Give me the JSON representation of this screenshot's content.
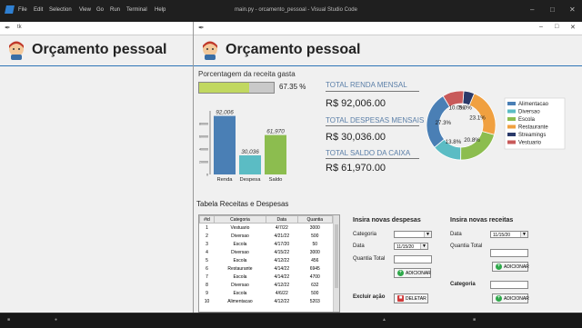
{
  "vscode": {
    "menu": [
      "File",
      "Edit",
      "Selection",
      "View",
      "Go",
      "Run",
      "Terminal",
      "Help"
    ],
    "title": "main.py - orcamento_pessoal - Visual Studio Code"
  },
  "window1": {
    "title": "tk",
    "app_title": "Orçamento pessoal"
  },
  "window2": {
    "app_title": "Orçamento pessoal"
  },
  "percent": {
    "title": "Porcentagem da receita gasta",
    "value_text": "67.35 %",
    "value": 0.6735
  },
  "stats": [
    {
      "label": "TOTAL RENDA MENSAL",
      "value": "R$ 92,006.00"
    },
    {
      "label": "TOTAL DESPESAS MENSAIS",
      "value": "R$ 30,036.00"
    },
    {
      "label": "TOTAL SALDO DA CAIXA",
      "value": "R$ 61,970.00"
    }
  ],
  "chart_data": [
    {
      "type": "bar",
      "categories": [
        "Renda",
        "Despesa",
        "Saldo"
      ],
      "values": [
        92006,
        30036,
        61970
      ],
      "value_labels": [
        "92,006",
        "30,036",
        "61,970"
      ],
      "colors": [
        "#4a7fb5",
        "#5bbcc4",
        "#8cbd4f"
      ],
      "yticks": [
        "80000",
        "60000",
        "40000",
        "20000",
        "0"
      ],
      "ylim": [
        0,
        100000
      ]
    },
    {
      "type": "pie",
      "donut": true,
      "labels": [
        "Alimentacao",
        "Diversao",
        "Escola",
        "Restaurante",
        "Streamings",
        "Vestuario"
      ],
      "values": [
        27.3,
        13.8,
        20.8,
        23.1,
        5.0,
        10.0
      ],
      "value_labels": [
        "27.3%",
        "13.8%",
        "20.8%",
        "23.1%",
        "5.0%",
        "10.0%"
      ],
      "colors": [
        "#4a7fb5",
        "#5bbcc4",
        "#8cbd4f",
        "#f0a040",
        "#2a3a6a",
        "#c85a5a"
      ],
      "legend": "right"
    }
  ],
  "table": {
    "title": "Tabela Receitas e Despesas",
    "headers": [
      "#id",
      "Categoria",
      "Data",
      "Quantia"
    ],
    "rows": [
      [
        "1",
        "Vestuario",
        "4/7/22",
        "3000"
      ],
      [
        "2",
        "Diversao",
        "4/21/22",
        "500"
      ],
      [
        "3",
        "Escola",
        "4/17/20",
        "50"
      ],
      [
        "4",
        "Diversao",
        "4/15/22",
        "3000"
      ],
      [
        "5",
        "Escola",
        "4/12/22",
        "456"
      ],
      [
        "6",
        "Restaurante",
        "4/14/22",
        "6945"
      ],
      [
        "7",
        "Escola",
        "4/14/22",
        "4700"
      ],
      [
        "8",
        "Diversao",
        "4/12/22",
        "632"
      ],
      [
        "9",
        "Escola",
        "4/6/22",
        "500"
      ],
      [
        "10",
        "Alimentacao",
        "4/12/22",
        "5203"
      ]
    ]
  },
  "expenses_form": {
    "title": "Insira novas despesas",
    "categoria_label": "Categoria",
    "data_label": "Data",
    "data_value": "11/15/20",
    "quantia_label": "Quantia Total",
    "add_label": "ADICIONAR",
    "delete_title": "Excluir ação",
    "delete_label": "DELETAR"
  },
  "income_form": {
    "title": "Insira novas receitas",
    "data_label": "Data",
    "data_value": "11/15/20",
    "quantia_label": "Quantia Total",
    "add_label": "ADICIONAR",
    "categoria_label": "Categoria",
    "add2_label": "ADICIONAR"
  },
  "colors": {
    "accent": "#2e75b6",
    "add_icon": "#2ea84a",
    "delete_icon": "#d03a3a"
  }
}
